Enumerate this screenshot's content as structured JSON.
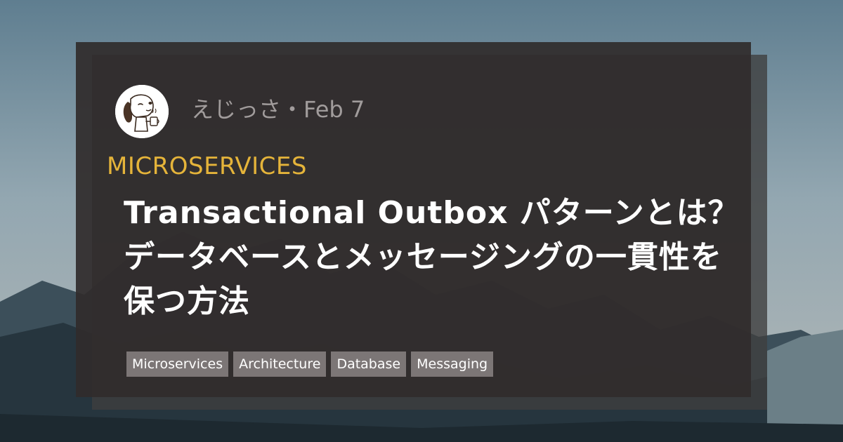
{
  "post": {
    "author": "えじっさ",
    "separator": "・",
    "date": "Feb 7",
    "category": "MICROSERVICES",
    "title": "Transactional Outbox パターンとは？データベースとメッセージングの一貫性を保つ方法"
  },
  "tags": [
    "Microservices",
    "Architecture",
    "Database",
    "Messaging"
  ],
  "colors": {
    "card": "#302c2c",
    "category": "#e5b43a",
    "meta_text": "#a19c9c",
    "tag_bg": "#7c7676",
    "title": "#ffffff"
  },
  "icons": {
    "avatar": "dog-with-coffee-mug-icon"
  }
}
